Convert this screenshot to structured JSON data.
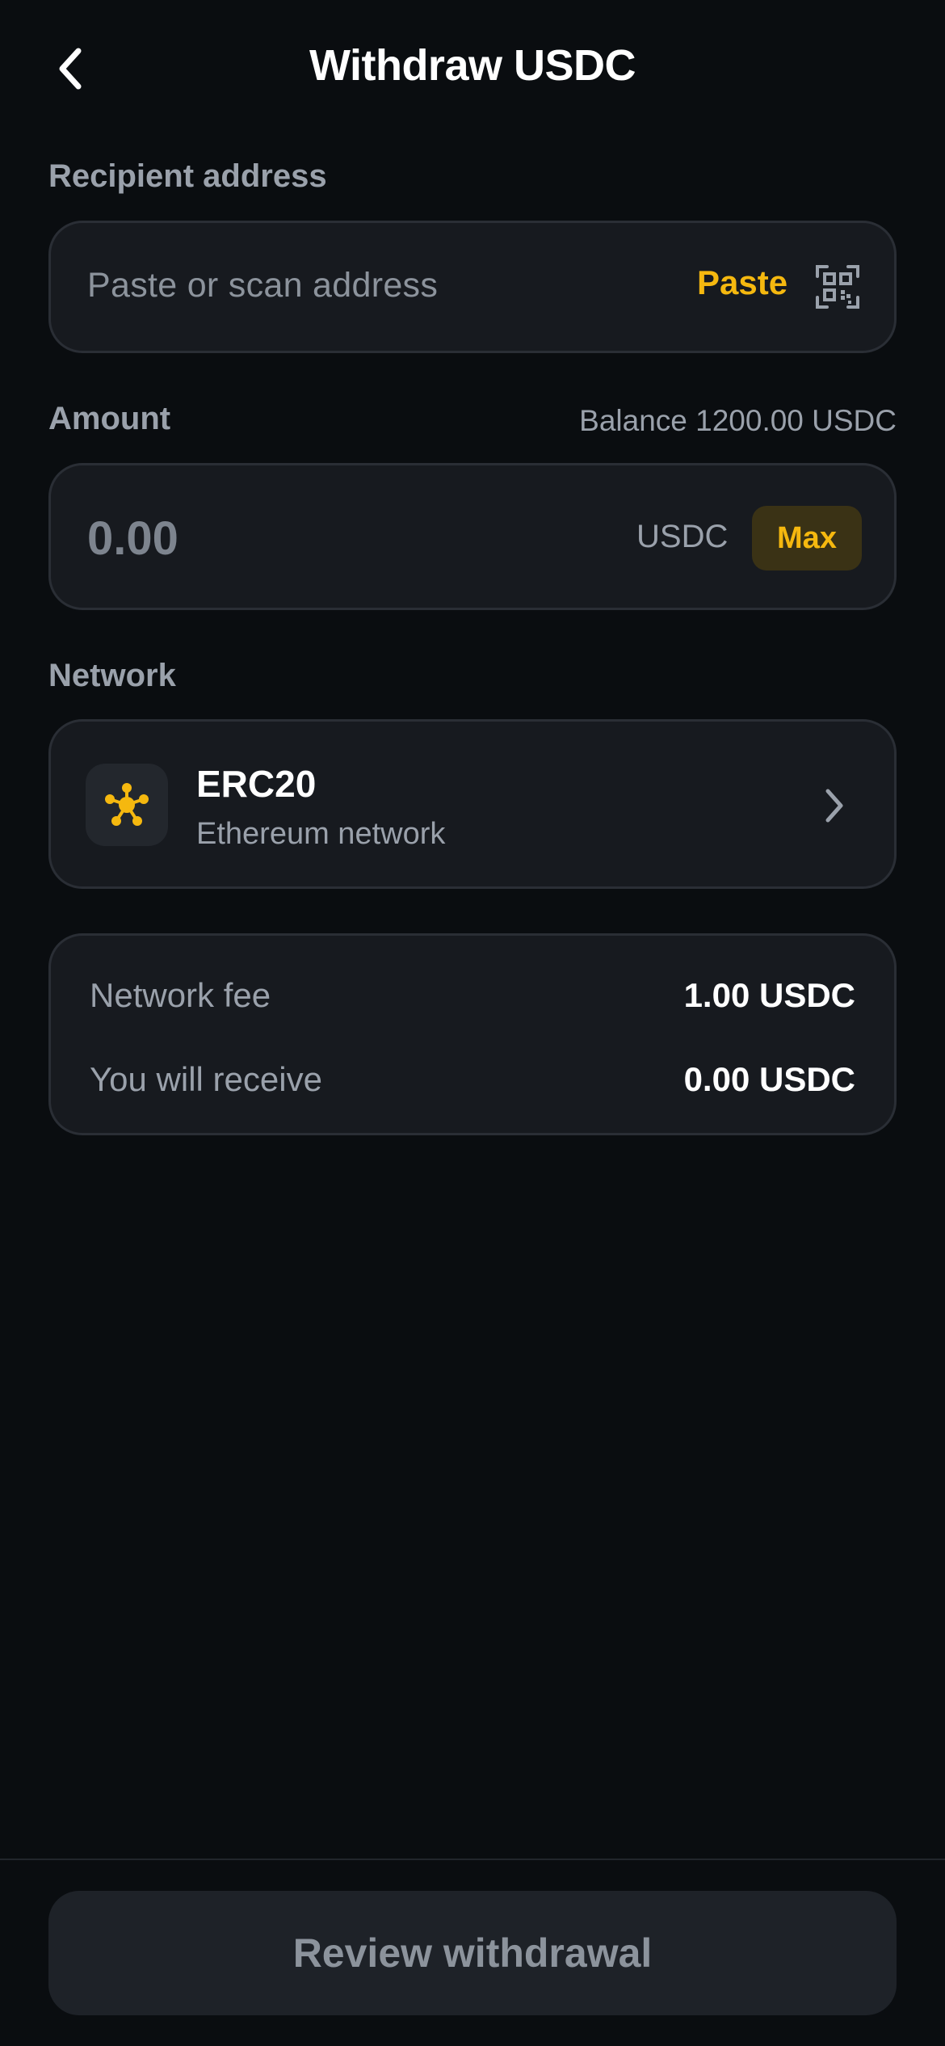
{
  "header": {
    "title": "Withdraw USDC",
    "back_icon": "chevron-left-icon"
  },
  "recipient": {
    "label": "Recipient address",
    "placeholder": "Paste or scan address",
    "paste_label": "Paste",
    "scan_icon": "qr-scan-icon"
  },
  "amount": {
    "label": "Amount",
    "balance_text": "Balance 1200.00 USDC",
    "value_placeholder": "0.00",
    "unit": "USDC",
    "max_label": "Max"
  },
  "network": {
    "label": "Network",
    "name": "ERC20",
    "description": "Ethereum network",
    "icon": "network-node-icon"
  },
  "summary": {
    "fee_label": "Network fee",
    "fee_value": "1.00 USDC",
    "receive_label": "You will receive",
    "receive_value": "0.00 USDC"
  },
  "footer": {
    "review_label": "Review withdrawal"
  },
  "colors": {
    "background": "#0a0d10",
    "card": "#171a1f",
    "accent": "#f5b80f",
    "muted_text": "#9aa1ab"
  }
}
